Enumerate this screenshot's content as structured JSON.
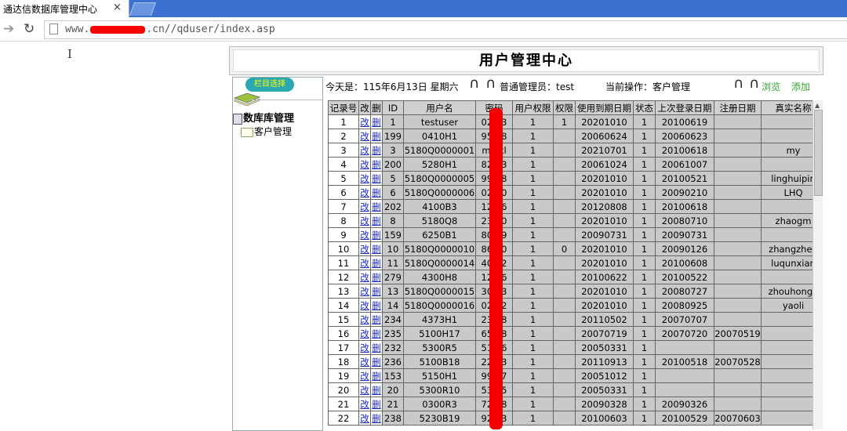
{
  "browser": {
    "tab_title": "通达信数据库管理中心",
    "tab_close": "×",
    "url_prefix": "www.",
    "url_suffix": ".cn//qduser/index.asp"
  },
  "page": {
    "title": "用户管理中心"
  },
  "sidebar": {
    "header": "栏目选择",
    "root": "数库库管理",
    "child": "客户管理"
  },
  "status": {
    "date_label": "今天是：115年6月13日 星期六",
    "role_label": "普通管理员：test",
    "op_label": "当前操作：客户管理",
    "browse": "浏览",
    "add": "添加"
  },
  "table": {
    "headers": [
      "记录号",
      "改",
      "删",
      "ID",
      "用户名",
      "密码",
      "用户权限",
      "权限",
      "使用到期日期",
      "状态",
      "上次登录日期",
      "注册日期",
      "真实名称"
    ],
    "edit_label": "改",
    "delete_label": "删",
    "rows": [
      [
        "1",
        "1",
        "testuser",
        "02  23",
        "1",
        "1",
        "20201010",
        "1",
        "20100619",
        "",
        ""
      ],
      [
        "2",
        "199",
        "0410H1",
        "95  58",
        "1",
        "",
        "20060624",
        "1",
        "20060623",
        "",
        ""
      ],
      [
        "3",
        "3",
        "5180Q0000001",
        "mk  kl",
        "1",
        "",
        "20210701",
        "1",
        "20100618",
        "",
        "my"
      ],
      [
        "4",
        "200",
        "5280H1",
        "82  03",
        "1",
        "",
        "20061024",
        "1",
        "20061007",
        "",
        ""
      ],
      [
        "5",
        "5",
        "5180Q0000005",
        "99  78",
        "1",
        "",
        "20201010",
        "1",
        "20100521",
        "",
        "linghuipin"
      ],
      [
        "6",
        "6",
        "5180Q0000006",
        "02  20",
        "1",
        "",
        "20201010",
        "1",
        "20090210",
        "",
        "LHQ"
      ],
      [
        "7",
        "202",
        "4100B3",
        "12  56",
        "1",
        "",
        "20120808",
        "1",
        "20100618",
        "",
        ""
      ],
      [
        "8",
        "8",
        "5180Q8",
        "23  30",
        "1",
        "",
        "20201010",
        "1",
        "20080710",
        "",
        "zhaogm"
      ],
      [
        "9",
        "159",
        "6250B1",
        "80  09",
        "1",
        "",
        "20090731",
        "1",
        "20090731",
        "",
        ""
      ],
      [
        "10",
        "10",
        "5180Q0000010",
        "86  30",
        "1",
        "0",
        "20201010",
        "1",
        "20090126",
        "",
        "zhangzhen"
      ],
      [
        "11",
        "11",
        "5180Q0000014",
        "40  02",
        "1",
        "",
        "20201010",
        "1",
        "20100608",
        "",
        "luqunxian"
      ],
      [
        "12",
        "279",
        "4300H8",
        "12  56",
        "1",
        "",
        "20100622",
        "1",
        "20100522",
        "",
        ""
      ],
      [
        "13",
        "13",
        "5180Q0000015",
        "30  03",
        "1",
        "",
        "20201010",
        "1",
        "20080727",
        "",
        "zhouhongb"
      ],
      [
        "14",
        "14",
        "5180Q0000016",
        "02  02",
        "1",
        "",
        "20201010",
        "1",
        "20080925",
        "",
        "yaoli"
      ],
      [
        "15",
        "234",
        "4373H1",
        "23  18",
        "1",
        "",
        "20110502",
        "1",
        "20070707",
        "",
        ""
      ],
      [
        "16",
        "235",
        "5100H17",
        "65  98",
        "1",
        "",
        "20070719",
        "1",
        "20070720",
        "20070519",
        ""
      ],
      [
        "17",
        "232",
        "5300R5",
        "51  36",
        "1",
        "",
        "20050331",
        "1",
        "",
        "",
        ""
      ],
      [
        "18",
        "236",
        "5100B18",
        "22  03",
        "1",
        "",
        "20110913",
        "1",
        "20100518",
        "20070528",
        ""
      ],
      [
        "19",
        "153",
        "5150H1",
        "99  17",
        "1",
        "",
        "20051012",
        "1",
        "",
        "",
        ""
      ],
      [
        "20",
        "20",
        "5300R10",
        "53  05",
        "1",
        "",
        "20050331",
        "1",
        "",
        "",
        ""
      ],
      [
        "21",
        "21",
        "0300R3",
        "72  58",
        "1",
        "",
        "20090328",
        "1",
        "20090326",
        "",
        ""
      ],
      [
        "22",
        "238",
        "5230B19",
        "92  23",
        "1",
        "",
        "20100603",
        "1",
        "20100529",
        "20070603",
        ""
      ]
    ]
  }
}
